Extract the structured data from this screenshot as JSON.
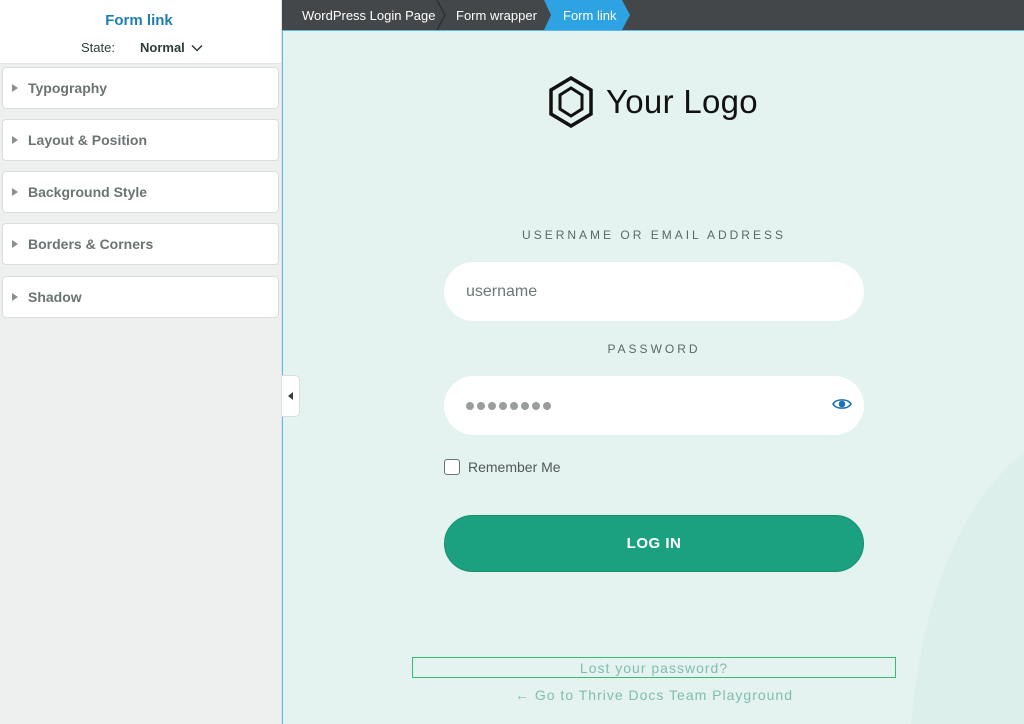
{
  "sidebar": {
    "title": "Form link",
    "state_label": "State:",
    "state_value": "Normal",
    "panels": [
      {
        "label": "Typography"
      },
      {
        "label": "Layout & Position"
      },
      {
        "label": "Background Style"
      },
      {
        "label": "Borders & Corners"
      },
      {
        "label": "Shadow"
      }
    ]
  },
  "breadcrumbs": [
    {
      "label": "WordPress Login Page"
    },
    {
      "label": "Form wrapper"
    },
    {
      "label": "Form link",
      "active": true
    }
  ],
  "login": {
    "logo_text": "Your Logo",
    "username_label": "USERNAME OR EMAIL ADDRESS",
    "username_value": "username",
    "password_label": "PASSWORD",
    "password_masked_length": 8,
    "remember_label": "Remember Me",
    "remember_checked": false,
    "login_button": "LOG IN",
    "lost_password": "Lost your password?",
    "back_link": "← Go to Thrive Docs Team Playground"
  },
  "colors": {
    "accent_blue": "#2ea3e4",
    "title_blue": "#1f7eb0",
    "login_green": "#1ba080",
    "canvas_bg": "#e4f2f0",
    "link_teal": "#7fbdb0"
  }
}
